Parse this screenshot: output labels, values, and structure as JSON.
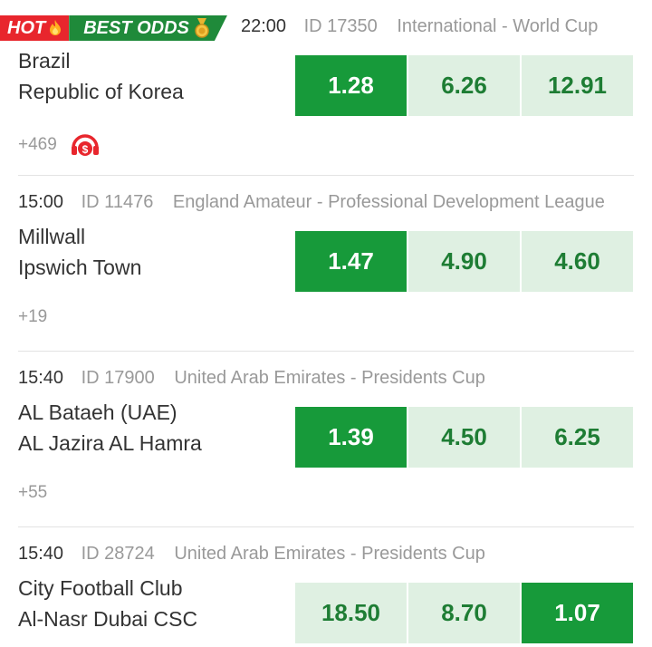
{
  "badges": {
    "hot": "HOT",
    "best_odds": "BEST ODDS"
  },
  "matches": [
    {
      "time": "22:00",
      "id": "ID 17350",
      "league": "International - World Cup",
      "home": "Brazil",
      "away": "Republic of Korea",
      "more": "+469",
      "odds": [
        "1.28",
        "6.26",
        "12.91"
      ],
      "selected": 0,
      "live_stream_icon": "headset-coin-icon"
    },
    {
      "time": "15:00",
      "id": "ID 11476",
      "league": "England Amateur - Professional Development League",
      "home": "Millwall",
      "away": "Ipswich Town",
      "more": "+19",
      "odds": [
        "1.47",
        "4.90",
        "4.60"
      ],
      "selected": 0
    },
    {
      "time": "15:40",
      "id": "ID 17900",
      "league": "United Arab Emirates - Presidents Cup",
      "home": "AL Bataeh (UAE)",
      "away": "AL Jazira AL Hamra",
      "more": "+55",
      "odds": [
        "1.39",
        "4.50",
        "6.25"
      ],
      "selected": 0
    },
    {
      "time": "15:40",
      "id": "ID 28724",
      "league": "United Arab Emirates - Presidents Cup",
      "home": "City Football Club",
      "away": "Al-Nasr Dubai CSC",
      "more": "",
      "odds": [
        "18.50",
        "8.70",
        "1.07"
      ],
      "selected": 2
    }
  ],
  "colors": {
    "selected_bg": "#179a3a",
    "odd_bg": "#dff0e2",
    "odd_text": "#1e7d34",
    "hot_red": "#e8262d",
    "badge_green": "#1f8a3a"
  }
}
